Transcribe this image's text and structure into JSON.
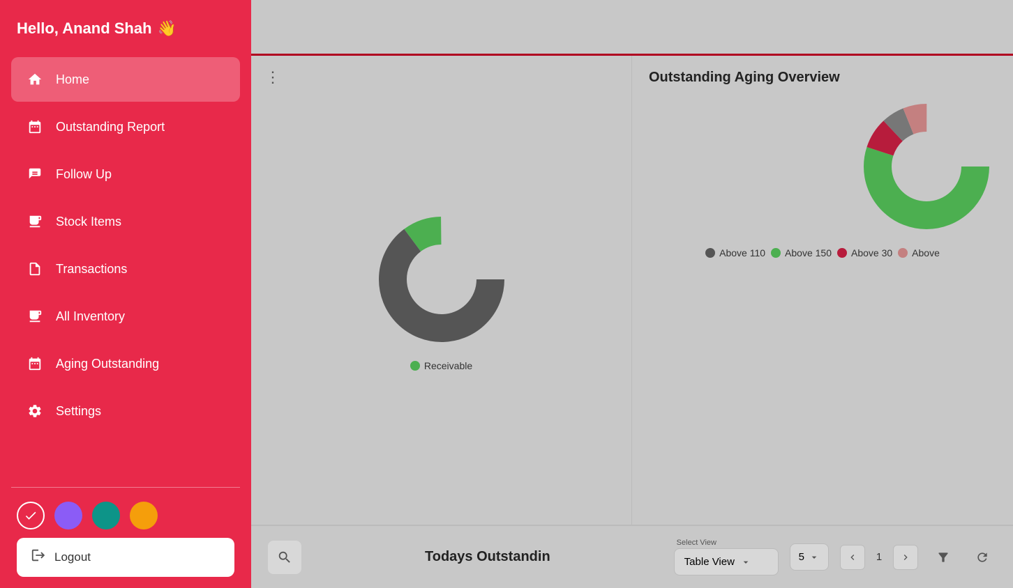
{
  "sidebar": {
    "greeting": "Hello, Anand Shah",
    "wave_emoji": "👋",
    "nav_items": [
      {
        "id": "home",
        "label": "Home",
        "icon": "🏠",
        "active": true
      },
      {
        "id": "outstanding-report",
        "label": "Outstanding Report",
        "icon": "📋",
        "active": false
      },
      {
        "id": "follow-up",
        "label": "Follow Up",
        "icon": "📝",
        "active": false
      },
      {
        "id": "stock-items",
        "label": "Stock Items",
        "icon": "🗂",
        "active": false
      },
      {
        "id": "transactions",
        "label": "Transactions",
        "icon": "📄",
        "active": false
      },
      {
        "id": "all-inventory",
        "label": "All Inventory",
        "icon": "🗂",
        "active": false
      },
      {
        "id": "aging-outstanding",
        "label": "Aging Outstanding",
        "icon": "📋",
        "active": false
      },
      {
        "id": "settings",
        "label": "Settings",
        "icon": "⚙️",
        "active": false
      }
    ],
    "theme_colors": [
      "#8b5cf6",
      "#0d9488",
      "#f59e0b"
    ],
    "logout_label": "Logout"
  },
  "main": {
    "left_chart": {
      "three_dots": "⋮",
      "legend": [
        {
          "label": "Receivable",
          "color": "#4caf50"
        }
      ]
    },
    "right_chart": {
      "title": "Outstanding Aging Overview",
      "legend": [
        {
          "label": "Above 110",
          "color": "#555555"
        },
        {
          "label": "Above 150",
          "color": "#4caf50"
        },
        {
          "label": "Above 30",
          "color": "#b71c3c"
        },
        {
          "label": "Above",
          "color": "#c48080"
        }
      ]
    },
    "todays_outstanding": {
      "title": "Todays Outstandin"
    },
    "bottom_bar": {
      "select_view_label": "Select View",
      "select_view_value": "Table View",
      "per_page_value": "5",
      "page_number": "1"
    }
  }
}
